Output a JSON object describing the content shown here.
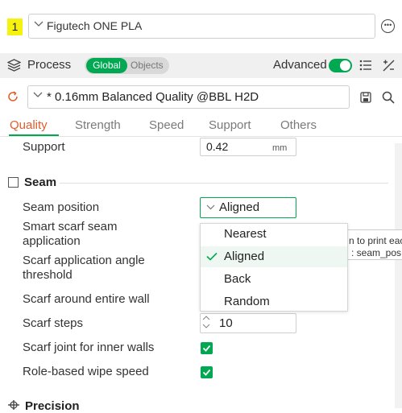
{
  "filament": {
    "index": "1",
    "name": "Figutech ONE PLA",
    "more_icon": "ellipsis-circle-icon"
  },
  "process": {
    "title": "Process",
    "toggle": {
      "global": "Global",
      "objects": "Objects"
    },
    "advanced_label": "Advanced",
    "advanced_on": true
  },
  "preset": {
    "name": "* 0.16mm Balanced Quality @BBL H2D"
  },
  "tabs": [
    {
      "label": "Quality",
      "active": true
    },
    {
      "label": "Strength"
    },
    {
      "label": "Speed"
    },
    {
      "label": "Support"
    },
    {
      "label": "Others"
    }
  ],
  "top_field": {
    "label": "Support",
    "value": "0.42",
    "unit": "mm"
  },
  "seam": {
    "title": "Seam",
    "position": {
      "label": "Seam position",
      "value": "Aligned"
    },
    "smart_scarf": {
      "label_line1": "Smart scarf seam",
      "label_line2": "application"
    },
    "scarf_angle": {
      "label_line1": "Scarf application angle",
      "label_line2": "threshold"
    },
    "scarf_entire_wall": {
      "label": "Scarf around entire wall"
    },
    "scarf_steps": {
      "label": "Scarf steps",
      "value": "10"
    },
    "scarf_inner": {
      "label": "Scarf joint for inner walls",
      "checked": true
    },
    "role_wipe": {
      "label": "Role-based wipe speed",
      "checked": true
    }
  },
  "dropdown": {
    "options": [
      "Nearest",
      "Aligned",
      "Back",
      "Random"
    ],
    "selected": "Aligned"
  },
  "tooltip": {
    "line1": "n to print eac",
    "line2": ": seam_pos"
  },
  "next_section": {
    "title": "Precision"
  },
  "colors": {
    "accent": "#00a852",
    "active_tab": "#e05c2e",
    "filament_badge": "#f5f20f"
  }
}
